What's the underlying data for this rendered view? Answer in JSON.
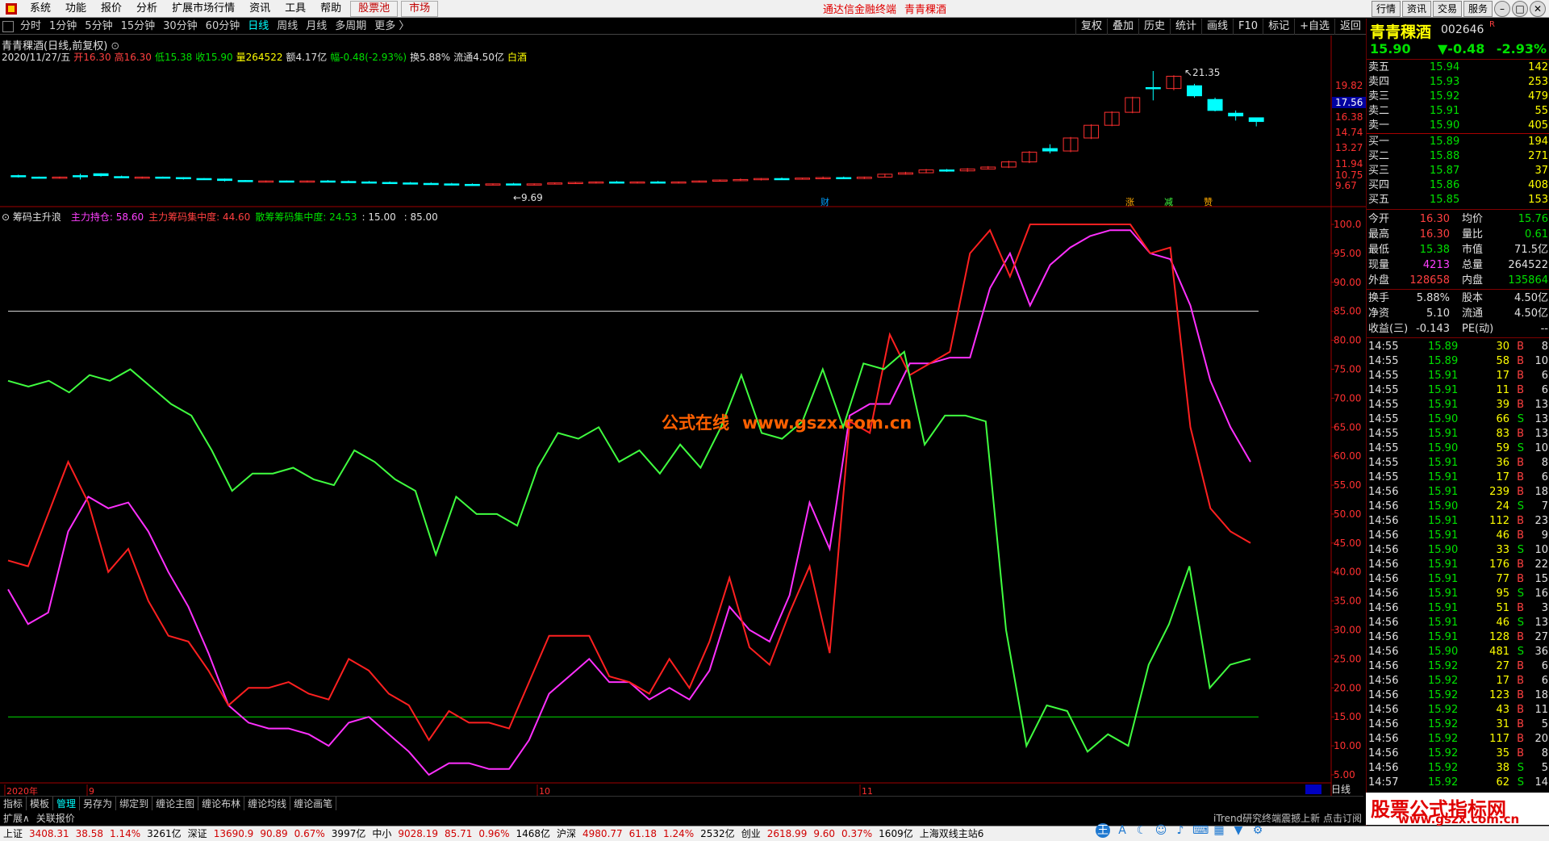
{
  "menu": {
    "items": [
      "系统",
      "功能",
      "报价",
      "分析",
      "扩展市场行情",
      "资讯",
      "工具",
      "帮助"
    ],
    "red_items": [
      "股票池",
      "市场"
    ],
    "center_title": [
      "通达信金融终端",
      "青青稞酒"
    ],
    "right_buttons": [
      "行情",
      "资讯",
      "交易",
      "服务"
    ],
    "window_controls": [
      "–",
      "□",
      "✕"
    ]
  },
  "periods": {
    "items": [
      "分时",
      "1分钟",
      "5分钟",
      "15分钟",
      "30分钟",
      "60分钟",
      "日线",
      "周线",
      "月线",
      "多周期",
      "更多 〉"
    ],
    "active": "日线"
  },
  "tools": [
    "复权",
    "叠加",
    "历史",
    "统计",
    "画线",
    "F10",
    "标记",
    "+自选",
    "返回"
  ],
  "kline": {
    "title": "青青稞酒(日线,前复权)",
    "date": "2020/11/27/五",
    "open": "开16.30",
    "high": "高16.30",
    "low": "低15.38",
    "close": "收15.90",
    "volume": "量264522",
    "amount": "额4.17亿",
    "change": "幅-0.48(-2.93%)",
    "turnover": "换5.88%",
    "float": "流通4.50亿",
    "sector": "白酒",
    "price_axis": [
      "19.82",
      "16.38",
      "14.74",
      "13.27",
      "11.94",
      "10.75",
      "9.67"
    ],
    "current_price_tag": "17.56",
    "max_label": "21.35",
    "min_label": "9.69",
    "markers": [
      "财",
      "涨",
      "减",
      "赞"
    ]
  },
  "indicator": {
    "name": "筹码主升浪",
    "main_holding": "主力持仓: 58.60",
    "main_concentration": "主力筹码集中度: 44.60",
    "retail_concentration": "散筹筹码集中度: 24.53",
    "level1": "15.00",
    "level2": "85.00",
    "axis": [
      "100.0",
      "95.00",
      "90.00",
      "85.00",
      "80.00",
      "75.00",
      "70.00",
      "65.00",
      "60.00",
      "55.00",
      "50.00",
      "45.00",
      "40.00",
      "35.00",
      "30.00",
      "25.00",
      "20.00",
      "15.00",
      "10.00",
      "5.00"
    ],
    "date_labels": [
      "2020年",
      "9",
      "10",
      "11"
    ]
  },
  "chart_data": {
    "type": "line",
    "title": "筹码主升浪",
    "ylim": [
      0,
      100
    ],
    "series": [
      {
        "name": "主力持仓",
        "color": "#ff30ff",
        "values": [
          37,
          31,
          33,
          47,
          53,
          51,
          52,
          47,
          40,
          34,
          26,
          17,
          14,
          13,
          13,
          12,
          10,
          14,
          15,
          12,
          9,
          5,
          7,
          7,
          6,
          6,
          11,
          19,
          22,
          25,
          21,
          21,
          18,
          20,
          18,
          23,
          34,
          30,
          28,
          36,
          52,
          44,
          67,
          69,
          69,
          76,
          76,
          77,
          77,
          89,
          95,
          86,
          93,
          96,
          98,
          99,
          99,
          95,
          94,
          86,
          73,
          65,
          59
        ]
      },
      {
        "name": "主力筹码集中度",
        "color": "#ff2020",
        "values": [
          42,
          41,
          50,
          59,
          52,
          40,
          44,
          35,
          29,
          28,
          23,
          17,
          20,
          20,
          21,
          19,
          18,
          25,
          23,
          19,
          17,
          11,
          16,
          14,
          14,
          13,
          21,
          29,
          29,
          29,
          22,
          21,
          19,
          25,
          20,
          28,
          39,
          27,
          24,
          33,
          41,
          26,
          66,
          64,
          81,
          74,
          76,
          78,
          95,
          99,
          91,
          100,
          100,
          100,
          100,
          100,
          100,
          95,
          96,
          65,
          51,
          47,
          45
        ]
      },
      {
        "name": "散筹筹码集中度",
        "color": "#40ff40",
        "values": [
          73,
          72,
          73,
          71,
          74,
          73,
          75,
          72,
          69,
          67,
          61,
          54,
          57,
          57,
          58,
          56,
          55,
          61,
          59,
          56,
          54,
          43,
          53,
          50,
          50,
          48,
          58,
          64,
          63,
          65,
          59,
          61,
          57,
          62,
          58,
          65,
          74,
          64,
          63,
          66,
          75,
          65,
          76,
          75,
          78,
          62,
          67,
          67,
          66,
          30,
          10,
          17,
          16,
          9,
          12,
          10,
          24,
          31,
          41,
          20,
          24,
          25
        ]
      }
    ],
    "levels": [
      15,
      85
    ]
  },
  "watermark": [
    "公式在线",
    "www.gszx.com.cn"
  ],
  "bottom_tabs": [
    "指标",
    "模板",
    "管理",
    "另存为",
    "绑定到",
    "缠论主图",
    "缠论布林",
    "缠论均线",
    "缠论画笔"
  ],
  "bottom_active": "管理",
  "expand_bar": [
    "扩展∧",
    "关联报价"
  ],
  "itrend": "iTrend研究终端震撼上新",
  "subscribe": "点击订阅",
  "day_line_label": "日线",
  "status": [
    {
      "text": "上证",
      "c": "black"
    },
    {
      "text": "3408.31",
      "c": "red"
    },
    {
      "text": "38.58",
      "c": "red"
    },
    {
      "text": "1.14%",
      "c": "red"
    },
    {
      "text": "3261亿",
      "c": "black"
    },
    {
      "text": "深证",
      "c": "black"
    },
    {
      "text": "13690.9",
      "c": "red"
    },
    {
      "text": "90.89",
      "c": "red"
    },
    {
      "text": "0.67%",
      "c": "red"
    },
    {
      "text": "3997亿",
      "c": "black"
    },
    {
      "text": "中小",
      "c": "black"
    },
    {
      "text": "9028.19",
      "c": "red"
    },
    {
      "text": "85.71",
      "c": "red"
    },
    {
      "text": "0.96%",
      "c": "red"
    },
    {
      "text": "1468亿",
      "c": "black"
    },
    {
      "text": "沪深",
      "c": "black"
    },
    {
      "text": "4980.77",
      "c": "red"
    },
    {
      "text": "61.18",
      "c": "red"
    },
    {
      "text": "1.24%",
      "c": "red"
    },
    {
      "text": "2532亿",
      "c": "black"
    },
    {
      "text": "创业",
      "c": "black"
    },
    {
      "text": "2618.99",
      "c": "red"
    },
    {
      "text": "9.60",
      "c": "red"
    },
    {
      "text": "0.37%",
      "c": "red"
    },
    {
      "text": "1609亿",
      "c": "black"
    },
    {
      "text": "上海双线主站6",
      "c": "black"
    }
  ],
  "quote": {
    "name": "青青稞酒",
    "code": "002646",
    "r": "R",
    "price": "15.90",
    "change": "▼-0.48",
    "pct": "-2.93%",
    "sells": [
      {
        "label": "卖五",
        "price": "15.94",
        "vol": "142"
      },
      {
        "label": "卖四",
        "price": "15.93",
        "vol": "253"
      },
      {
        "label": "卖三",
        "price": "15.92",
        "vol": "479"
      },
      {
        "label": "卖二",
        "price": "15.91",
        "vol": "55"
      },
      {
        "label": "卖一",
        "price": "15.90",
        "vol": "405"
      }
    ],
    "buys": [
      {
        "label": "买一",
        "price": "15.89",
        "vol": "194"
      },
      {
        "label": "买二",
        "price": "15.88",
        "vol": "271"
      },
      {
        "label": "买三",
        "price": "15.87",
        "vol": "37"
      },
      {
        "label": "买四",
        "price": "15.86",
        "vol": "408"
      },
      {
        "label": "买五",
        "price": "15.85",
        "vol": "153"
      }
    ],
    "stats": [
      {
        "l1": "今开",
        "v1": "16.30",
        "c1": "red",
        "l2": "均价",
        "v2": "15.76",
        "c2": "green"
      },
      {
        "l1": "最高",
        "v1": "16.30",
        "c1": "red",
        "l2": "量比",
        "v2": "0.61",
        "c2": "green"
      },
      {
        "l1": "最低",
        "v1": "15.38",
        "c1": "green",
        "l2": "市值",
        "v2": "71.5亿",
        "c2": "white"
      },
      {
        "l1": "现量",
        "v1": "4213",
        "c1": "mag",
        "l2": "总量",
        "v2": "264522",
        "c2": "white"
      },
      {
        "l1": "外盘",
        "v1": "128658",
        "c1": "red",
        "l2": "内盘",
        "v2": "135864",
        "c2": "green"
      }
    ],
    "stats2": [
      {
        "l1": "换手",
        "v1": "5.88%",
        "l2": "股本",
        "v2": "4.50亿"
      },
      {
        "l1": "净资",
        "v1": "5.10",
        "l2": "流通",
        "v2": "4.50亿"
      },
      {
        "l1": "收益(三)",
        "v1": "-0.143",
        "l2": "PE(动)",
        "v2": "--"
      }
    ],
    "ticks": [
      {
        "t": "14:55",
        "p": "15.89",
        "v": "30",
        "bs": "B",
        "n": "8"
      },
      {
        "t": "14:55",
        "p": "15.89",
        "v": "58",
        "bs": "B",
        "n": "10"
      },
      {
        "t": "14:55",
        "p": "15.91",
        "v": "17",
        "bs": "B",
        "n": "6"
      },
      {
        "t": "14:55",
        "p": "15.91",
        "v": "11",
        "bs": "B",
        "n": "6"
      },
      {
        "t": "14:55",
        "p": "15.91",
        "v": "39",
        "bs": "B",
        "n": "13"
      },
      {
        "t": "14:55",
        "p": "15.90",
        "v": "66",
        "bs": "S",
        "n": "13"
      },
      {
        "t": "14:55",
        "p": "15.91",
        "v": "83",
        "bs": "B",
        "n": "13"
      },
      {
        "t": "14:55",
        "p": "15.90",
        "v": "59",
        "bs": "S",
        "n": "10"
      },
      {
        "t": "14:55",
        "p": "15.91",
        "v": "36",
        "bs": "B",
        "n": "8"
      },
      {
        "t": "14:55",
        "p": "15.91",
        "v": "17",
        "bs": "B",
        "n": "6"
      },
      {
        "t": "14:56",
        "p": "15.91",
        "v": "239",
        "bs": "B",
        "n": "18"
      },
      {
        "t": "14:56",
        "p": "15.90",
        "v": "24",
        "bs": "S",
        "n": "7"
      },
      {
        "t": "14:56",
        "p": "15.91",
        "v": "112",
        "bs": "B",
        "n": "23"
      },
      {
        "t": "14:56",
        "p": "15.91",
        "v": "46",
        "bs": "B",
        "n": "9"
      },
      {
        "t": "14:56",
        "p": "15.90",
        "v": "33",
        "bs": "S",
        "n": "10"
      },
      {
        "t": "14:56",
        "p": "15.91",
        "v": "176",
        "bs": "B",
        "n": "22"
      },
      {
        "t": "14:56",
        "p": "15.91",
        "v": "77",
        "bs": "B",
        "n": "15"
      },
      {
        "t": "14:56",
        "p": "15.91",
        "v": "95",
        "bs": "S",
        "n": "16"
      },
      {
        "t": "14:56",
        "p": "15.91",
        "v": "51",
        "bs": "B",
        "n": "3"
      },
      {
        "t": "14:56",
        "p": "15.91",
        "v": "46",
        "bs": "S",
        "n": "13"
      },
      {
        "t": "14:56",
        "p": "15.91",
        "v": "128",
        "bs": "B",
        "n": "27"
      },
      {
        "t": "14:56",
        "p": "15.90",
        "v": "481",
        "bs": "S",
        "n": "36"
      },
      {
        "t": "14:56",
        "p": "15.92",
        "v": "27",
        "bs": "B",
        "n": "6"
      },
      {
        "t": "14:56",
        "p": "15.92",
        "v": "17",
        "bs": "B",
        "n": "6"
      },
      {
        "t": "14:56",
        "p": "15.92",
        "v": "123",
        "bs": "B",
        "n": "18"
      },
      {
        "t": "14:56",
        "p": "15.92",
        "v": "43",
        "bs": "B",
        "n": "11"
      },
      {
        "t": "14:56",
        "p": "15.92",
        "v": "31",
        "bs": "B",
        "n": "5"
      },
      {
        "t": "14:56",
        "p": "15.92",
        "v": "117",
        "bs": "B",
        "n": "20"
      },
      {
        "t": "14:56",
        "p": "15.92",
        "v": "35",
        "bs": "B",
        "n": "8"
      },
      {
        "t": "14:56",
        "p": "15.92",
        "v": "38",
        "bs": "S",
        "n": "5"
      },
      {
        "t": "14:57",
        "p": "15.92",
        "v": "62",
        "bs": "S",
        "n": "14"
      }
    ]
  },
  "logo_text": [
    "股票公式指标网",
    "www.gszx.com.cn"
  ]
}
